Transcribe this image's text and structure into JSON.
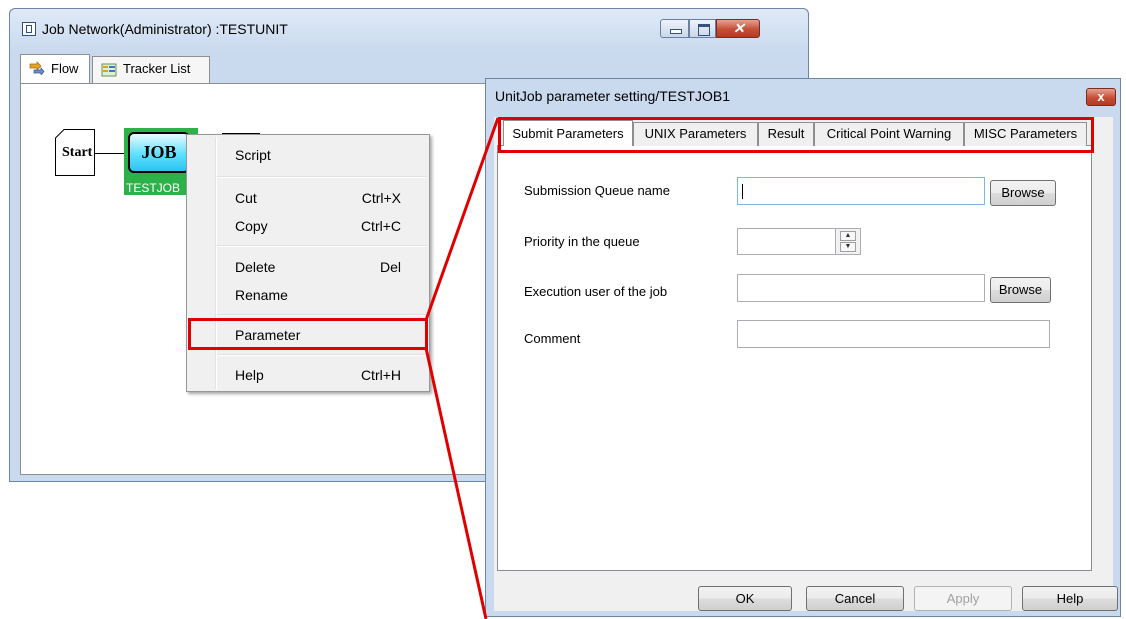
{
  "main_window": {
    "title": "Job Network(Administrator) :TESTUNIT",
    "tabs": [
      {
        "label": "Flow",
        "active": true
      },
      {
        "label": "Tracker List",
        "active": false
      }
    ]
  },
  "flow": {
    "start_label": "Start",
    "job_text": "JOB",
    "job_name": "TESTJOB"
  },
  "context_menu": {
    "items": [
      {
        "label": "Script",
        "shortcut": ""
      },
      {
        "label": "Cut",
        "shortcut": "Ctrl+X"
      },
      {
        "label": "Copy",
        "shortcut": "Ctrl+C"
      },
      {
        "label": "Delete",
        "shortcut": "Del"
      },
      {
        "label": "Rename",
        "shortcut": ""
      },
      {
        "label": "Parameter",
        "shortcut": ""
      },
      {
        "label": "Help",
        "shortcut": "Ctrl+H"
      }
    ]
  },
  "dialog": {
    "title": "UnitJob parameter setting/TESTJOB1",
    "close_glyph": "x",
    "tabs": [
      {
        "label": "Submit Parameters",
        "active": true
      },
      {
        "label": "UNIX Parameters",
        "active": false
      },
      {
        "label": "Result",
        "active": false
      },
      {
        "label": "Critical Point Warning",
        "active": false
      },
      {
        "label": "MISC Parameters",
        "active": false
      }
    ],
    "fields": {
      "queue_label": "Submission Queue name",
      "queue_value": "",
      "priority_label": "Priority in the queue",
      "priority_value": "",
      "user_label": "Execution user of the job",
      "user_value": "",
      "comment_label": "Comment",
      "comment_value": ""
    },
    "browse_label": "Browse",
    "buttons": {
      "ok": "OK",
      "cancel": "Cancel",
      "apply": "Apply",
      "help": "Help"
    }
  },
  "colors": {
    "highlight_red": "#e00000",
    "job_green": "#2db24a",
    "window_frame": "#c9d9ee"
  }
}
